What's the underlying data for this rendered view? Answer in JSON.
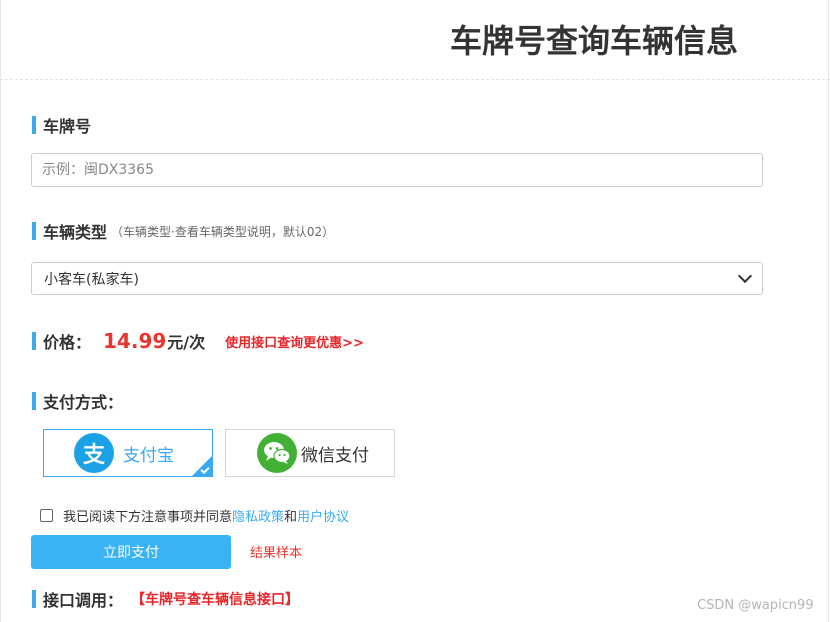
{
  "header": {
    "title": "车牌号查询车辆信息"
  },
  "plate": {
    "label": "车牌号",
    "placeholder": "示例：闽DX3365"
  },
  "vehicle_type": {
    "label": "车辆类型",
    "note": "（车辆类型·查看车辆类型说明，默认02）",
    "selected": "小客车(私家车)"
  },
  "price": {
    "label": "价格：",
    "value": "14.99",
    "unit": "元/次",
    "link": "使用接口查询更优惠>>"
  },
  "payment": {
    "label": "支付方式：",
    "options": [
      {
        "label": "支付宝",
        "selected": true,
        "icon": "alipay-icon"
      },
      {
        "label": "微信支付",
        "selected": false,
        "icon": "wechat-icon"
      }
    ]
  },
  "agreement": {
    "text_prefix": "我已阅读下方注意事项并同意",
    "privacy_link": "隐私政策",
    "and": "和",
    "user_link": "用户协议",
    "checked": false
  },
  "actions": {
    "pay_button": "立即支付",
    "sample_link": "结果样本"
  },
  "api": {
    "label": "接口调用：",
    "link": "【车牌号查车辆信息接口】"
  },
  "watermark": "CSDN @wapicn99",
  "colors": {
    "accent": "#3aa9f0",
    "price_red": "#e8352e",
    "alipay_blue": "#1aa1e6",
    "wechat_green": "#42b035"
  }
}
